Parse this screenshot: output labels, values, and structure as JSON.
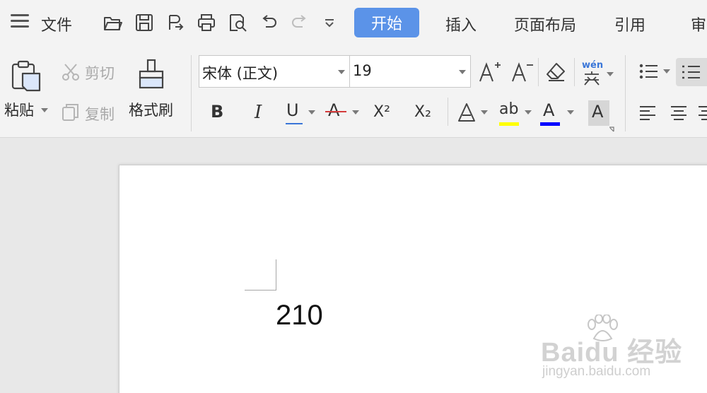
{
  "menubar": {
    "file_label": "文件",
    "tabs": [
      {
        "label": "开始",
        "active": true
      },
      {
        "label": "插入"
      },
      {
        "label": "页面布局"
      },
      {
        "label": "引用"
      },
      {
        "label": "审"
      }
    ],
    "quick_access_icons": [
      "open-icon",
      "save-icon",
      "export-icon",
      "print-icon",
      "print-preview-icon",
      "undo-icon",
      "redo-icon",
      "more-icon"
    ]
  },
  "ribbon": {
    "paste_label": "粘贴",
    "cut_label": "剪切",
    "copy_label": "复制",
    "format_painter_label": "格式刷",
    "font_name": "宋体 (正文)",
    "font_size": "19",
    "phonetic_label": "wén",
    "bold_label": "B",
    "italic_label": "I",
    "underline_label": "U",
    "strike_label": "A",
    "superscript_label": "X²",
    "subscript_label": "X₂",
    "text_effect_label": "A",
    "highlight_label": "ab",
    "font_color_label": "A",
    "char_shading_label": "A",
    "highlight_color": "#ffff00",
    "font_color": "#0000ff",
    "accent_color": "#5b93e8"
  },
  "document": {
    "text": "210"
  },
  "watermark": {
    "brand": "Baidu 经验",
    "url": "jingyan.baidu.com"
  }
}
